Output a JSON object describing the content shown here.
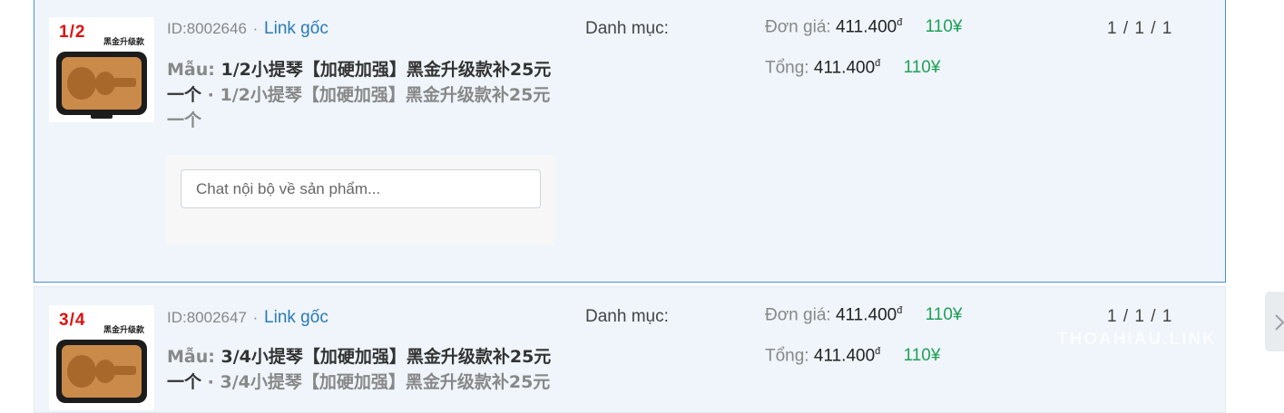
{
  "items": [
    {
      "size_label": "1/2",
      "brand_label": "黑金升级款",
      "id_text": "ID:8002646",
      "separator": "·",
      "link_label": "Link gốc",
      "variant_label": "Mẫu:",
      "variant_main": "1/2小提琴【加硬加强】黑金升级款补25元一个",
      "variant_dot": "·",
      "variant_sub": "1/2小提琴【加硬加强】黑金升级款补25元一个",
      "chat_placeholder": "Chat nội bộ về sản phẩm...",
      "category_label": "Danh mục:",
      "unit_price_label": "Đơn giá:",
      "unit_price_vnd": "411.400",
      "currency_vnd": "đ",
      "unit_price_cny": "110¥",
      "total_label": "Tổng:",
      "total_vnd": "411.400",
      "total_cny": "110¥",
      "quantity": "1 / 1 / 1"
    },
    {
      "size_label": "3/4",
      "brand_label": "黑金升级款",
      "id_text": "ID:8002647",
      "separator": "·",
      "link_label": "Link gốc",
      "variant_label": "Mẫu:",
      "variant_main": "3/4小提琴【加硬加强】黑金升级款补25元一个",
      "variant_dot": "·",
      "variant_sub": "3/4小提琴【加硬加强】黑金升级款补25元",
      "category_label": "Danh mục:",
      "unit_price_label": "Đơn giá:",
      "unit_price_vnd": "411.400",
      "currency_vnd": "đ",
      "unit_price_cny": "110¥",
      "total_label": "Tổng:",
      "total_vnd": "411.400",
      "total_cny": "110¥",
      "quantity": "1 / 1 / 1"
    }
  ],
  "watermark": "THOAHIAU.LINK",
  "colors": {
    "accent_link": "#2a7ab8",
    "cny_green": "#1fa055",
    "selected_border": "#4a90d9",
    "size_red": "#e01010"
  },
  "icons": {
    "next": "chevron-right-icon"
  }
}
